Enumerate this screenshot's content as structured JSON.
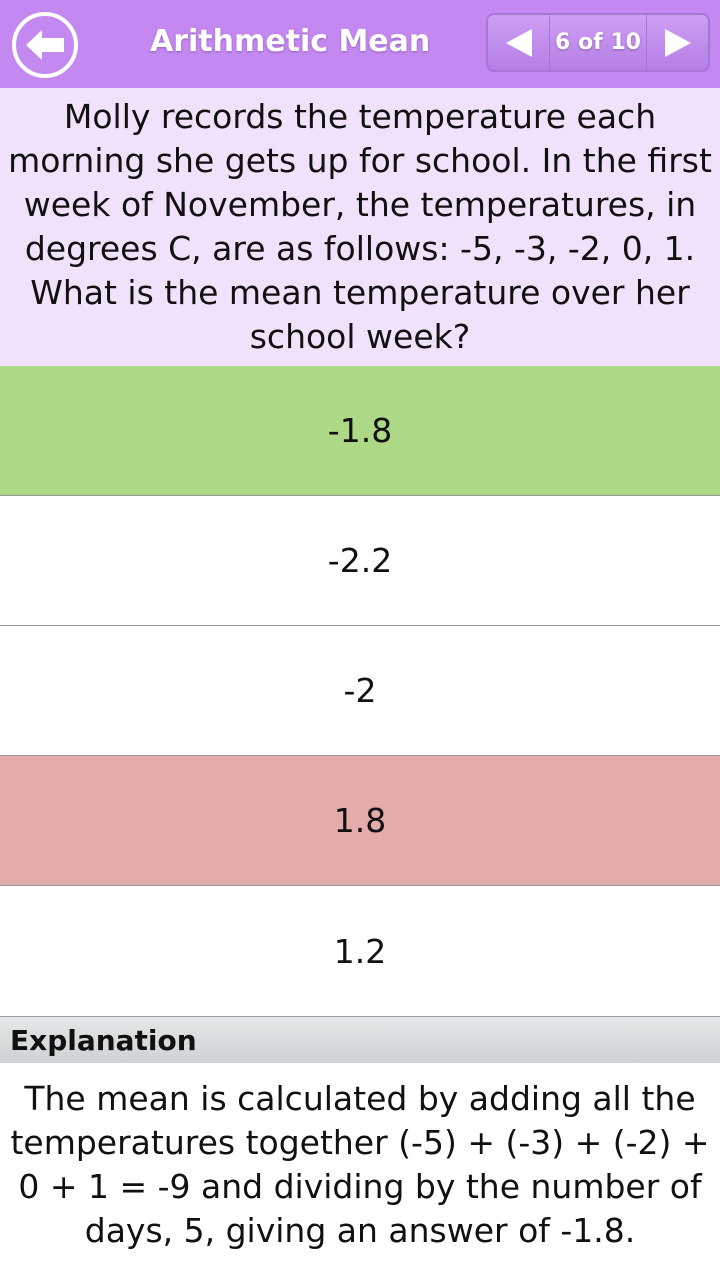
{
  "header": {
    "title": "Arithmetic Mean",
    "back_icon": "arrow-left-icon",
    "pager": {
      "count_label": "6 of 10",
      "prev_icon": "triangle-left-icon",
      "next_icon": "triangle-right-icon"
    },
    "colors": {
      "header_bg": "#c389f0"
    }
  },
  "question": {
    "text": "Molly records the temperature each morning she gets up for school. In the first week of November, the temperatures, in degrees C, are as follows: -5, -3, -2, 0, 1. What is the mean temperature over her school week?"
  },
  "answers": [
    {
      "label": "-1.8",
      "state": "correct"
    },
    {
      "label": "-2.2",
      "state": "neutral"
    },
    {
      "label": "-2",
      "state": "neutral"
    },
    {
      "label": "1.8",
      "state": "wrong"
    },
    {
      "label": "1.2",
      "state": "neutral"
    }
  ],
  "colors": {
    "correct": "#add886",
    "wrong": "#e4abab",
    "question_bg": "#f1e2fb"
  },
  "explanation": {
    "heading": "Explanation",
    "text": "The mean is calculated by adding all the temperatures together (-5) + (-3) + (-2) + 0 + 1 = -9 and dividing by the number of days, 5, giving an answer of -1.8."
  }
}
